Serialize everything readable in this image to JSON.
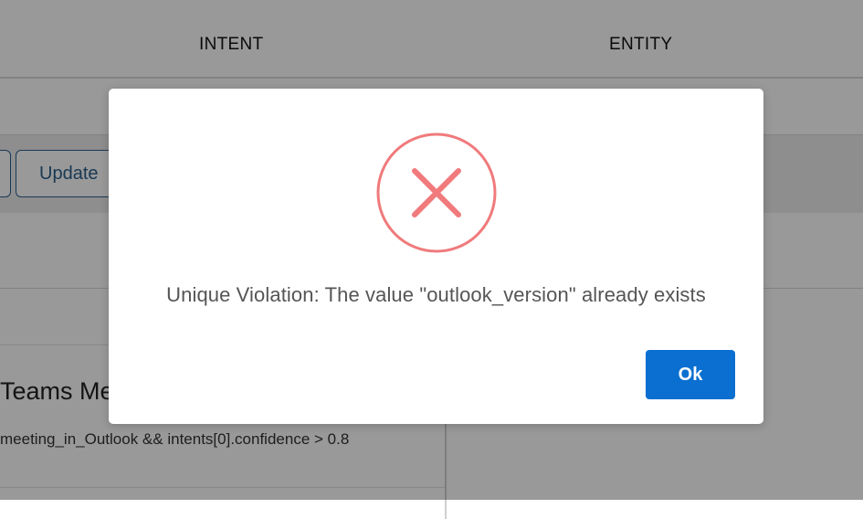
{
  "tabs": [
    {
      "label": "INTENT"
    },
    {
      "label": "ENTITY"
    }
  ],
  "toolbar": {
    "update_label": "Update"
  },
  "card": {
    "title": "Teams Me",
    "condition": "meeting_in_Outlook && intents[0].confidence > 0.8"
  },
  "modal": {
    "icon": "error-x-circle-icon",
    "message": "Unique Violation: The value \"outlook_version\" already exists",
    "ok_label": "Ok"
  },
  "colors": {
    "error": "#f07a7c",
    "primary": "#0a6fd0",
    "outline_button": "#2b5f8d"
  }
}
